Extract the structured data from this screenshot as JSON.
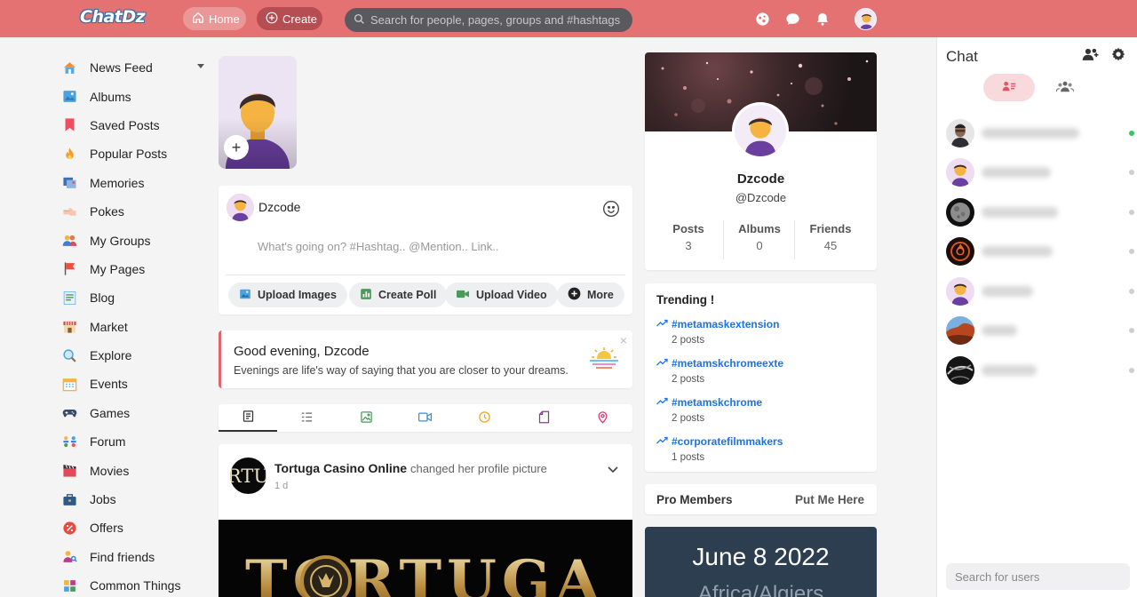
{
  "header": {
    "logo": "ChatDz",
    "home_label": "Home",
    "create_label": "Create",
    "search_placeholder": "Search for people, pages, groups and #hashtags",
    "icons": [
      "globe-icon",
      "chat-icon",
      "bell-icon"
    ],
    "colors": {
      "bar": "#e47273",
      "home_bg": "#ec9797",
      "create_bg": "#b54d52"
    }
  },
  "sidebar": {
    "items": [
      {
        "label": "News Feed",
        "icon": "home-icon"
      },
      {
        "label": "Albums",
        "icon": "albums-icon"
      },
      {
        "label": "Saved Posts",
        "icon": "bookmark-icon"
      },
      {
        "label": "Popular Posts",
        "icon": "popular-icon"
      },
      {
        "label": "Memories",
        "icon": "memories-icon"
      },
      {
        "label": "Pokes",
        "icon": "poke-icon"
      },
      {
        "label": "My Groups",
        "icon": "groups-icon"
      },
      {
        "label": "My Pages",
        "icon": "flag-icon"
      },
      {
        "label": "Blog",
        "icon": "blog-icon"
      },
      {
        "label": "Market",
        "icon": "market-icon"
      },
      {
        "label": "Explore",
        "icon": "explore-icon"
      },
      {
        "label": "Events",
        "icon": "events-icon"
      },
      {
        "label": "Games",
        "icon": "gamepad-icon"
      },
      {
        "label": "Forum",
        "icon": "forum-icon"
      },
      {
        "label": "Movies",
        "icon": "movies-icon"
      },
      {
        "label": "Jobs",
        "icon": "jobs-icon"
      },
      {
        "label": "Offers",
        "icon": "offers-icon"
      },
      {
        "label": "Find friends",
        "icon": "find-friends-icon"
      },
      {
        "label": "Common Things",
        "icon": "common-things-icon"
      }
    ]
  },
  "composer": {
    "username": "Dzcode",
    "placeholder": "What's going on? #Hashtag.. @Mention.. Link..",
    "actions": [
      {
        "label": "Upload Images",
        "icon": "image-icon"
      },
      {
        "label": "Create Poll",
        "icon": "poll-icon"
      },
      {
        "label": "Upload Video",
        "icon": "video-icon"
      },
      {
        "label": "More",
        "icon": "more-icon"
      }
    ]
  },
  "greeting": {
    "title": "Good evening, Dzcode",
    "subtitle": "Evenings are life's way of saying that you are closer to your dreams.",
    "close": "×"
  },
  "feed_tabs": [
    "all-posts-icon",
    "text-posts-icon",
    "photos-icon",
    "videos-icon",
    "music-icon",
    "files-icon",
    "maps-icon"
  ],
  "post": {
    "author": "Tortuga Casino Online",
    "action": "changed her profile picture",
    "time": "1 d",
    "avatar_text": "RTU",
    "image_text": "TORTUGA"
  },
  "profile": {
    "name": "Dzcode",
    "handle": "@Dzcode",
    "stats": [
      {
        "label": "Posts",
        "value": "3"
      },
      {
        "label": "Albums",
        "value": "0"
      },
      {
        "label": "Friends",
        "value": "45"
      }
    ]
  },
  "trending": {
    "title": "Trending !",
    "items": [
      {
        "tag": "#metamaskextension",
        "count": "2 posts"
      },
      {
        "tag": "#metamskchromeexte",
        "count": "2 posts"
      },
      {
        "tag": "#metamskchrome",
        "count": "2 posts"
      },
      {
        "tag": "#corporatefilmmakers",
        "count": "1 posts"
      }
    ]
  },
  "pro_members": {
    "title": "Pro Members",
    "action": "Put Me Here"
  },
  "date_widget": {
    "date": "June 8 2022",
    "timezone": "Africa/Algiers"
  },
  "chat": {
    "title": "Chat",
    "search_placeholder": "Search for users",
    "users": [
      {
        "status": "online",
        "avatar": "man-photo"
      },
      {
        "status": "offline",
        "avatar": "default-avatar"
      },
      {
        "status": "offline",
        "avatar": "moon-photo"
      },
      {
        "status": "offline",
        "avatar": "flame-logo"
      },
      {
        "status": "offline",
        "avatar": "default-avatar"
      },
      {
        "status": "offline",
        "avatar": "landscape-photo"
      },
      {
        "status": "offline",
        "avatar": "dark-abstract"
      }
    ]
  }
}
